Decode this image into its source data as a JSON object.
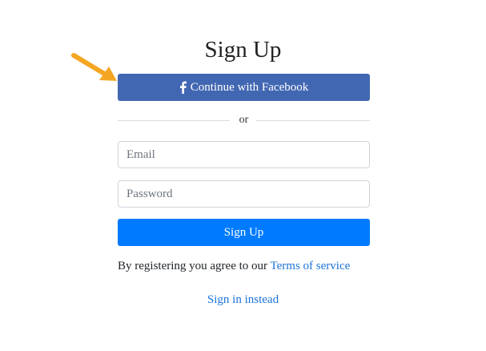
{
  "page": {
    "title": "Sign Up"
  },
  "facebook_button": {
    "label": "Continue with Facebook",
    "icon": "facebook-f-icon",
    "color": "#4267b2"
  },
  "divider": {
    "text": "or"
  },
  "form": {
    "email_placeholder": "Email",
    "email_value": "",
    "password_placeholder": "Password",
    "password_value": "",
    "submit_label": "Sign Up",
    "submit_color": "#007bff"
  },
  "terms": {
    "prefix": "By registering you agree to our ",
    "link_label": "Terms of service"
  },
  "signin": {
    "link_label": "Sign in instead"
  },
  "annotation": {
    "icon": "arrow-icon",
    "color": "#f5a623"
  }
}
